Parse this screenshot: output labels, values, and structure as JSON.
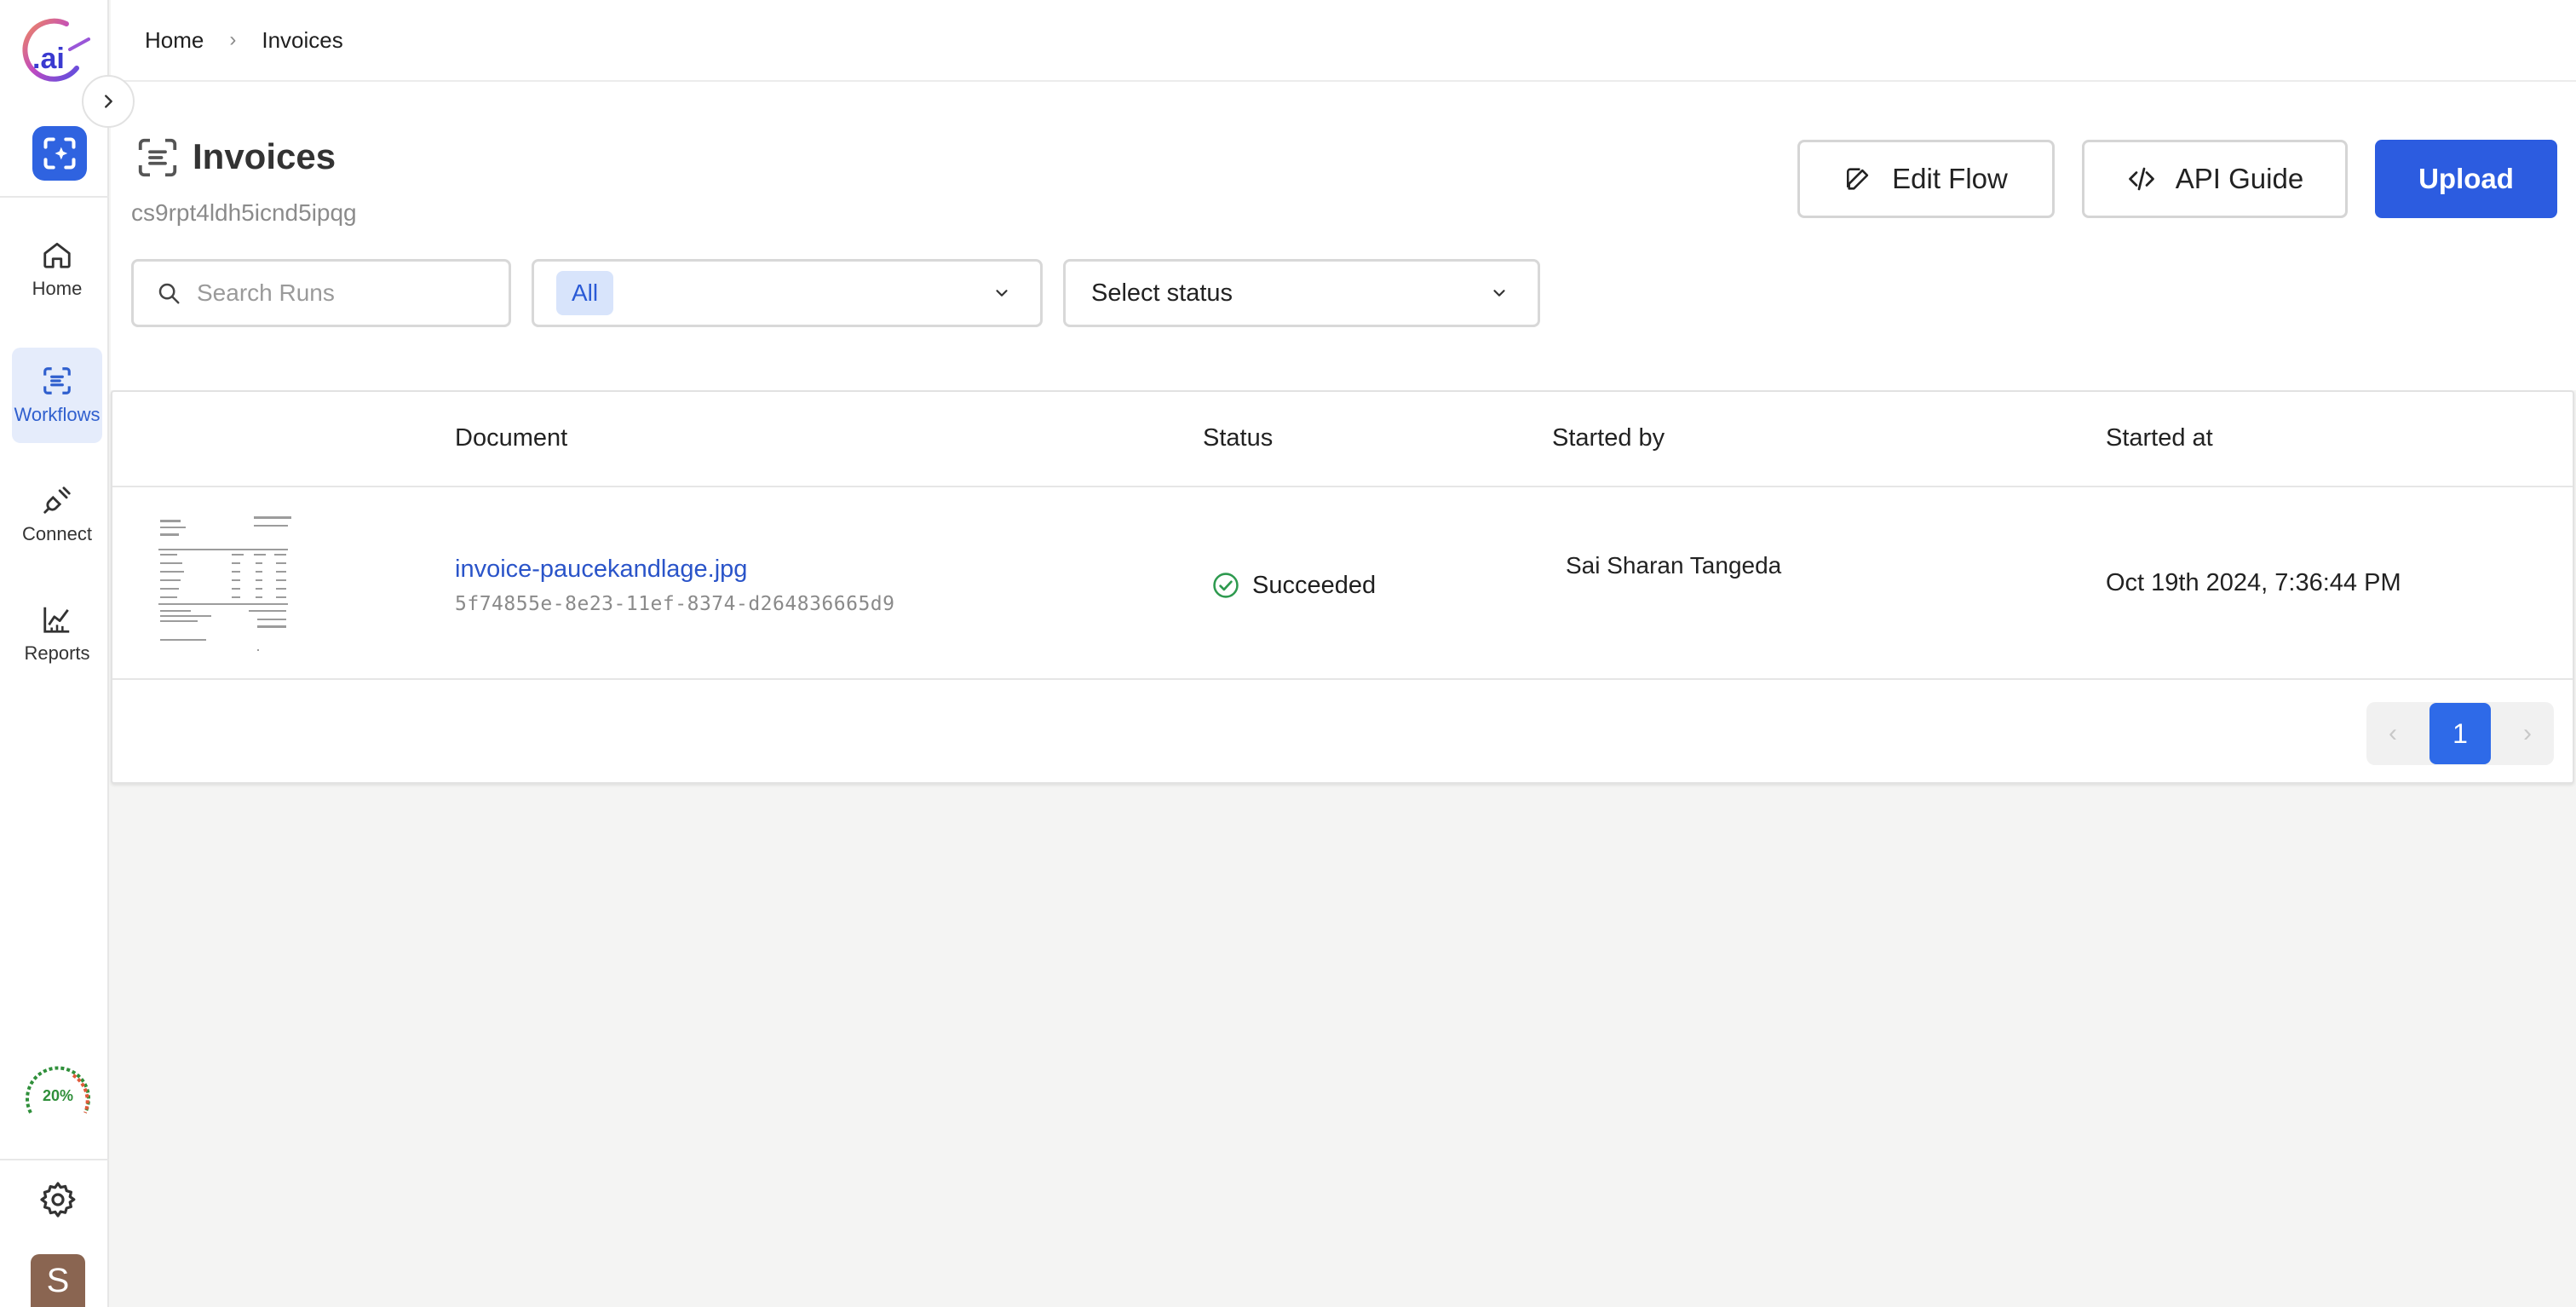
{
  "sidebar": {
    "logo_text": ".ai",
    "items": [
      {
        "label": "Home",
        "icon": "home-icon"
      },
      {
        "label": "Workflows",
        "icon": "workflow-icon"
      },
      {
        "label": "Connect",
        "icon": "plug-icon"
      },
      {
        "label": "Reports",
        "icon": "chart-icon"
      }
    ],
    "usage_gauge": "20%",
    "avatar_initial": "S"
  },
  "breadcrumb": {
    "home": "Home",
    "current": "Invoices"
  },
  "header": {
    "title": "Invoices",
    "subtitle": "cs9rpt4ldh5icnd5ipqg",
    "edit_flow_label": "Edit Flow",
    "api_guide_label": "API Guide",
    "upload_label": "Upload"
  },
  "filters": {
    "search_placeholder": "Search Runs",
    "type_selected": "All",
    "status_placeholder": "Select status"
  },
  "table": {
    "columns": [
      "Document",
      "Status",
      "Started by",
      "Started at"
    ],
    "rows": [
      {
        "document": "invoice-paucekandlage.jpg",
        "document_id": "5f74855e-8e23-11ef-8374-d264836665d9",
        "status": "Succeeded",
        "started_by": "Sai Sharan Tangeda",
        "started_at": "Oct 19th 2024, 7:36:44 PM"
      }
    ]
  },
  "pagination": {
    "current_page": "1"
  },
  "colors": {
    "primary": "#2c5ce0",
    "success": "#2e9a4f",
    "link": "#2a54c9"
  }
}
